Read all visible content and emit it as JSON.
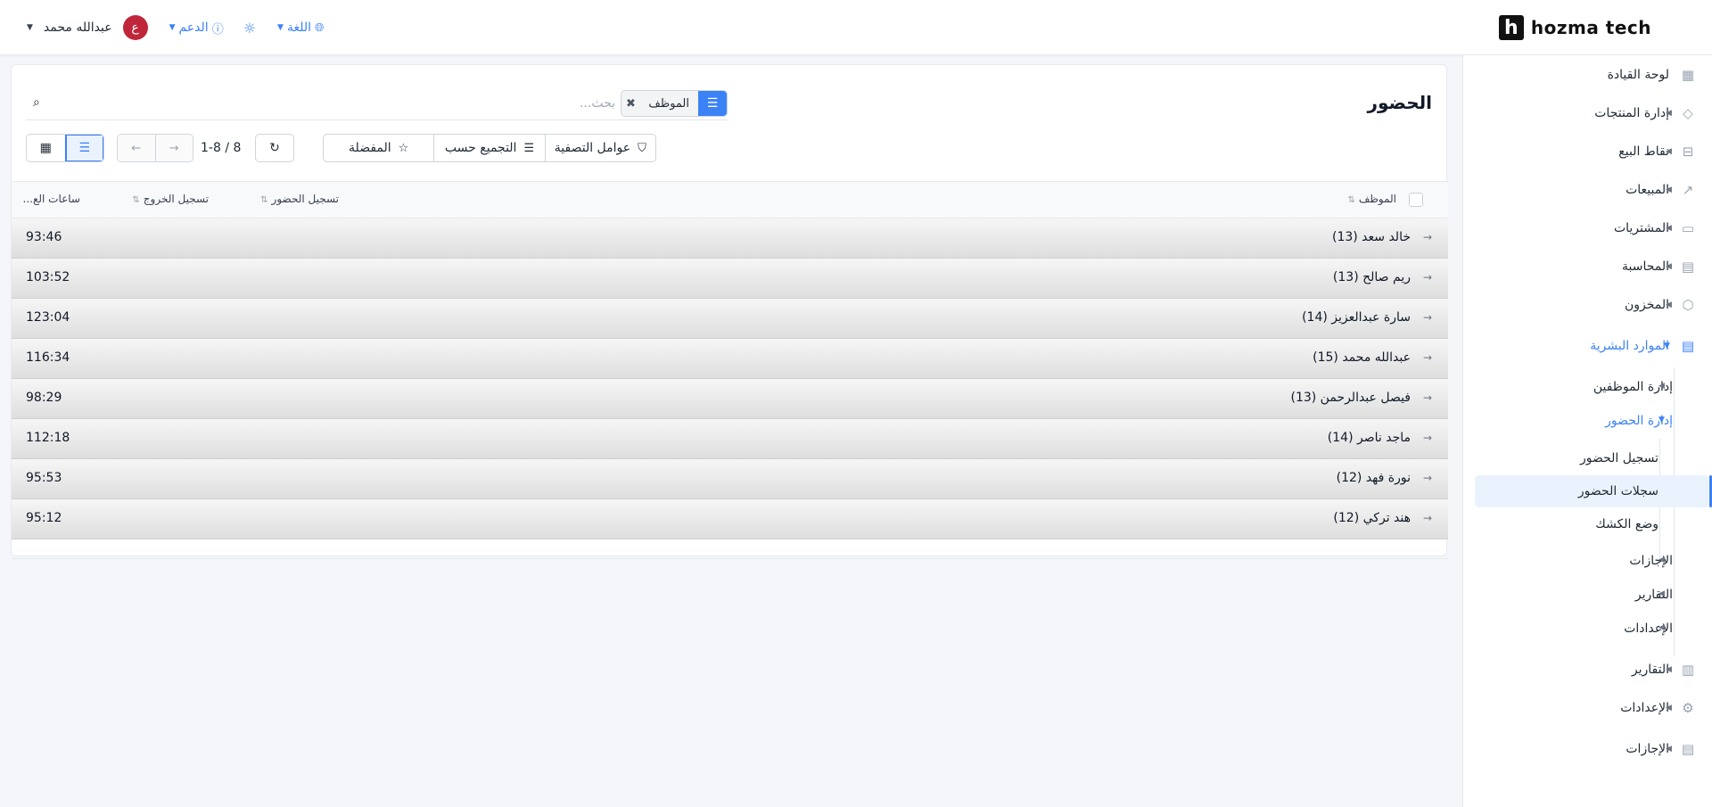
{
  "brand": {
    "mark": "h",
    "name": "hozma tech"
  },
  "topbar": {
    "user_name": "عبدالله محمد",
    "avatar_initial": "ع",
    "support_label": "الدعم",
    "language_label": "اللغة"
  },
  "sidebar": {
    "items": [
      {
        "label": "لوحة القيادة",
        "icon": "dashboard-icon"
      },
      {
        "label": "إدارة المنتجات",
        "icon": "tag-icon"
      },
      {
        "label": "نقاط البيع",
        "icon": "store-icon"
      },
      {
        "label": "المبيعات",
        "icon": "chart-line-icon"
      },
      {
        "label": "المشتريات",
        "icon": "cart-icon"
      },
      {
        "label": "المحاسبة",
        "icon": "calculator-icon"
      },
      {
        "label": "المخزون",
        "icon": "box-icon"
      },
      {
        "label": "الموارد البشرية",
        "icon": "hr-icon"
      },
      {
        "label": "التقارير",
        "icon": "report-icon"
      },
      {
        "label": "الإعدادات",
        "icon": "gear-icon"
      },
      {
        "label": "الإجازات",
        "icon": "document-icon"
      }
    ],
    "hr_children": [
      {
        "label": "إدارة الموظفين"
      },
      {
        "label": "إدارة الحضور"
      },
      {
        "label": "الإجازات"
      },
      {
        "label": "التقارير"
      },
      {
        "label": "الإعدادات"
      }
    ],
    "attendance_children": [
      {
        "label": "تسجيل الحضور"
      },
      {
        "label": "سجلات الحضور"
      },
      {
        "label": "وضع الكشك"
      }
    ]
  },
  "page": {
    "title": "الحضور",
    "search_placeholder": "بحث...",
    "facet_label": "الموظف",
    "filters_label": "عوامل التصفية",
    "group_by_label": "التجميع حسب",
    "favorites_label": "المفضلة",
    "pager_text": "1-8 / 8"
  },
  "table": {
    "columns": {
      "employee": "الموظف",
      "check_in": "تسجيل الحضور",
      "check_out": "تسجيل الخروج",
      "hours": "ساعات الع..."
    },
    "groups": [
      {
        "name": "خالد سعد (13)",
        "hours": "93:46"
      },
      {
        "name": "ريم صالح (13)",
        "hours": "103:52"
      },
      {
        "name": "سارة عبدالعزيز (14)",
        "hours": "123:04"
      },
      {
        "name": "عبدالله محمد (15)",
        "hours": "116:34"
      },
      {
        "name": "فيصل عبدالرحمن (13)",
        "hours": "98:29"
      },
      {
        "name": "ماجد ناصر (14)",
        "hours": "112:18"
      },
      {
        "name": "نورة فهد (12)",
        "hours": "95:53"
      },
      {
        "name": "هند تركي (12)",
        "hours": "95:12"
      }
    ]
  },
  "colors": {
    "accent": "#3b82f6",
    "avatar": "#c0263a"
  }
}
